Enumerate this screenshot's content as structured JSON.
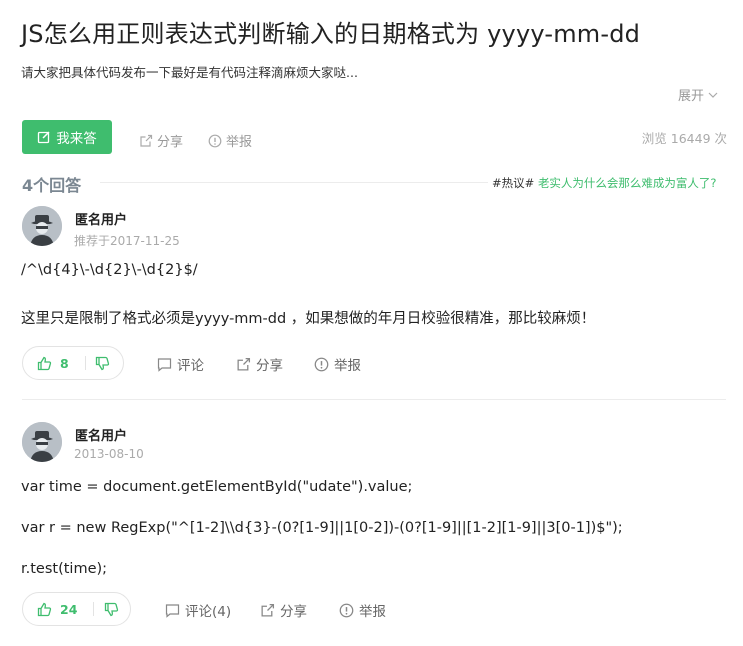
{
  "question": {
    "title": "JS怎么用正则表达式判断输入的日期格式为 yyyy-mm-dd",
    "description": "请大家把具体代码发布一下最好是有代码注释滴麻烦大家哒...",
    "expand_label": "展开",
    "answer_button": "我来答",
    "share_label": "分享",
    "report_label": "举报",
    "views": "浏览 16449 次"
  },
  "answers_header": {
    "count_label": "4个回答",
    "hot_tag": "#热议#",
    "hot_link": "老实人为什么会那么难成为富人了?"
  },
  "answers": [
    {
      "user": "匿名用户",
      "date": "推荐于2017-11-25",
      "lines": [
        "/^\\d{4}\\-\\d{2}\\-\\d{2}$/",
        "这里只是限制了格式必须是yyyy-mm-dd ，如果想做的年月日校验很精准，那比较麻烦！"
      ],
      "upvotes": "8",
      "comment_label": "评论",
      "share_label": "分享",
      "report_label": "举报"
    },
    {
      "user": "匿名用户",
      "date": "2013-08-10",
      "lines": [
        "var time = document.getElementById(\"udate\").value;",
        "var r = new RegExp(\"^[1-2]\\\\d{3}-(0?[1-9]||1[0-2])-(0?[1-9]||[1-2][1-9]||3[0-1])$\");",
        "r.test(time);"
      ],
      "upvotes": "24",
      "comment_label": "评论(4)",
      "share_label": "分享",
      "report_label": "举报"
    }
  ],
  "colors": {
    "accent": "#3fbd6e",
    "muted": "#999999",
    "divider": "#ececec"
  }
}
